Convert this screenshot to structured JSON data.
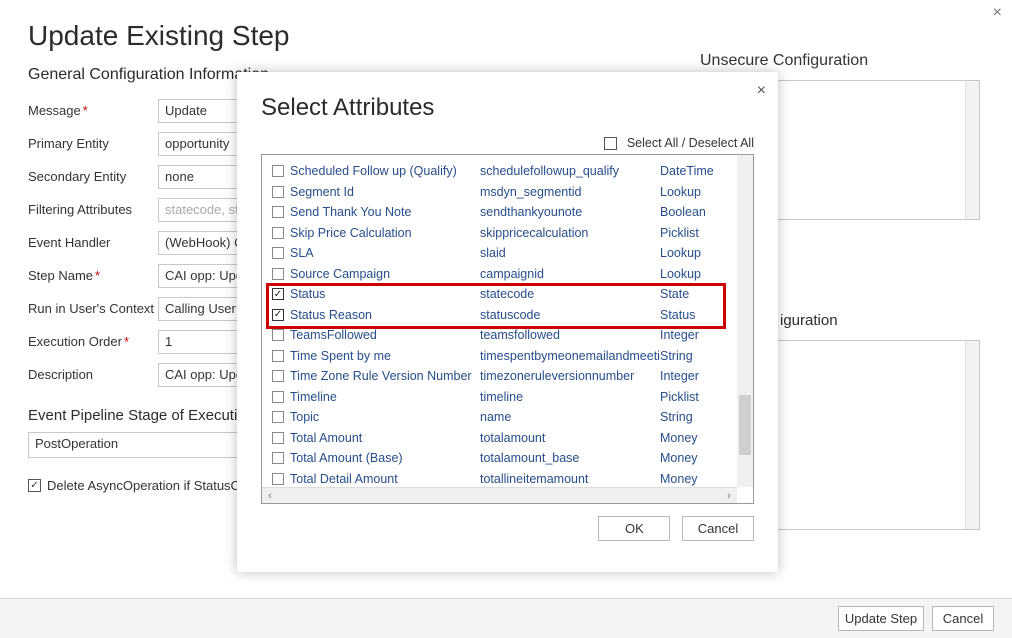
{
  "window": {
    "title": "Update Existing Step",
    "close_icon": "×"
  },
  "general": {
    "heading": "General Configuration Information",
    "fields": {
      "message": {
        "label": "Message",
        "value": "Update",
        "required": true
      },
      "primary_entity": {
        "label": "Primary Entity",
        "value": "opportunity",
        "required": false
      },
      "secondary_entity": {
        "label": "Secondary Entity",
        "value": "none",
        "required": false
      },
      "filtering_attributes": {
        "label": "Filtering Attributes",
        "placeholder": "statecode, st",
        "required": false
      },
      "event_handler": {
        "label": "Event Handler",
        "value": "(WebHook) C",
        "required": false
      },
      "step_name": {
        "label": "Step Name",
        "value": "CAI opp: Upda",
        "required": true
      },
      "user_context": {
        "label": "Run in User's Context",
        "value": "Calling User",
        "required": false
      },
      "execution_order": {
        "label": "Execution Order",
        "value": "1",
        "required": true
      },
      "description": {
        "label": "Description",
        "value": "CAI opp: Upda",
        "required": false
      }
    },
    "pipeline": {
      "heading": "Event Pipeline Stage of Execution",
      "value": "PostOperation"
    },
    "delete_async": {
      "label": "Delete AsyncOperation if StatusCode",
      "checked": true
    }
  },
  "right": {
    "unsecure_heading": "Unsecure Configuration",
    "secure_heading_tail": "iguration"
  },
  "modal": {
    "title": "Select Attributes",
    "close_icon": "×",
    "select_all_label": "Select All / Deselect All",
    "ok_label": "OK",
    "cancel_label": "Cancel",
    "attributes": [
      {
        "display": "Scheduled Follow up (Qualify)",
        "name": "schedulefollowup_qualify",
        "type": "DateTime",
        "checked": false
      },
      {
        "display": "Segment Id",
        "name": "msdyn_segmentid",
        "type": "Lookup",
        "checked": false
      },
      {
        "display": "Send Thank You Note",
        "name": "sendthankyounote",
        "type": "Boolean",
        "checked": false
      },
      {
        "display": "Skip Price Calculation",
        "name": "skippricecalculation",
        "type": "Picklist",
        "checked": false
      },
      {
        "display": "SLA",
        "name": "slaid",
        "type": "Lookup",
        "checked": false
      },
      {
        "display": "Source Campaign",
        "name": "campaignid",
        "type": "Lookup",
        "checked": false
      },
      {
        "display": "Status",
        "name": "statecode",
        "type": "State",
        "checked": true
      },
      {
        "display": "Status Reason",
        "name": "statuscode",
        "type": "Status",
        "checked": true
      },
      {
        "display": "TeamsFollowed",
        "name": "teamsfollowed",
        "type": "Integer",
        "checked": false
      },
      {
        "display": "Time Spent by me",
        "name": "timespentbymeonemailandmeeti",
        "type": "String",
        "checked": false
      },
      {
        "display": "Time Zone Rule Version Number",
        "name": "timezoneruleversionnumber",
        "type": "Integer",
        "checked": false
      },
      {
        "display": "Timeline",
        "name": "timeline",
        "type": "Picklist",
        "checked": false
      },
      {
        "display": "Topic",
        "name": "name",
        "type": "String",
        "checked": false
      },
      {
        "display": "Total Amount",
        "name": "totalamount",
        "type": "Money",
        "checked": false
      },
      {
        "display": "Total Amount (Base)",
        "name": "totalamount_base",
        "type": "Money",
        "checked": false
      },
      {
        "display": "Total Detail Amount",
        "name": "totallineitemamount",
        "type": "Money",
        "checked": false
      }
    ]
  },
  "footer": {
    "update_label": "Update Step",
    "cancel_label": "Cancel"
  }
}
